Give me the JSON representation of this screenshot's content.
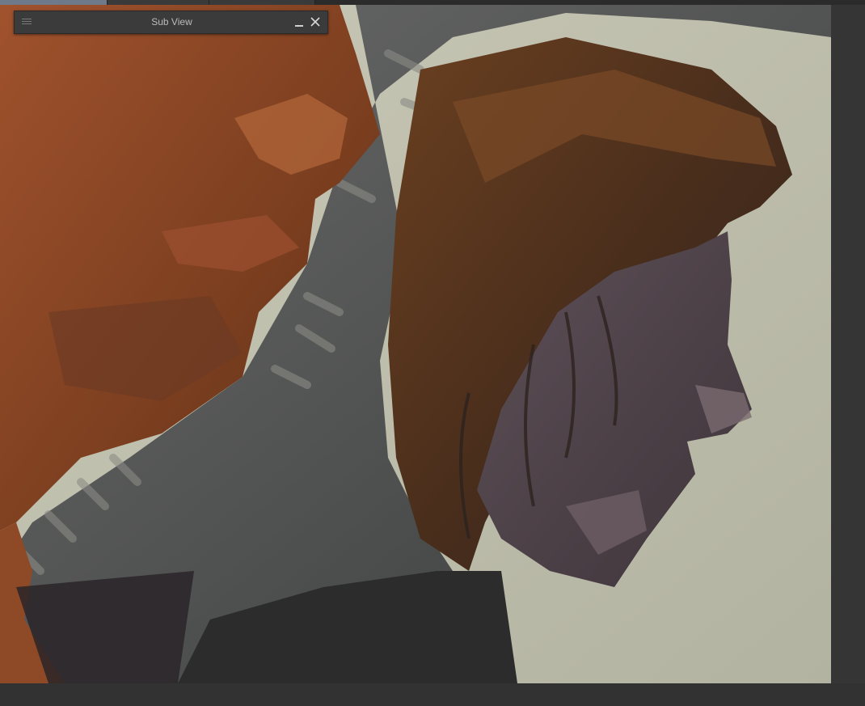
{
  "subview": {
    "title": "Sub View",
    "menu_icon": "hamburger-menu-icon",
    "minimize_icon": "minimize-icon",
    "close_icon": "close-icon"
  },
  "colors": {
    "app_background": "#303030",
    "panel_background": "#3b3b3b",
    "canvas_paper": "#b9b8a6"
  }
}
